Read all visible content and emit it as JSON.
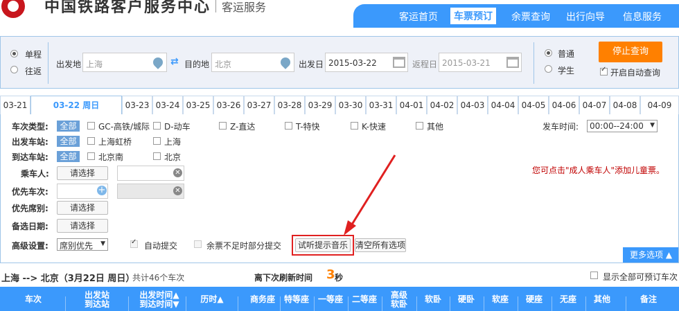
{
  "header": {
    "brand": "中国铁路客户服务中心",
    "sub": "客运服务",
    "nav": [
      "客运首页",
      "车票预订",
      "余票查询",
      "出行向导",
      "信息服务"
    ],
    "nav_active": 1
  },
  "search": {
    "trip_type": [
      "单程",
      "往返"
    ],
    "from_label": "出发地",
    "from_value": "上海",
    "to_label": "目的地",
    "to_value": "北京",
    "depart_label": "出发日",
    "depart_value": "2015-03-22",
    "return_label": "返程日",
    "return_value": "2015-03-21",
    "ticket_type": [
      "普通",
      "学生"
    ],
    "stop_button": "停止查询",
    "auto_query": "开启自动查询"
  },
  "date_tabs": [
    "03-21",
    "03-22  周日",
    "03-23",
    "03-24",
    "03-25",
    "03-26",
    "03-27",
    "03-28",
    "03-29",
    "03-30",
    "03-31",
    "04-01",
    "04-02",
    "04-03",
    "04-04",
    "04-05",
    "04-06",
    "04-07",
    "04-08",
    "04-09"
  ],
  "filters": {
    "train_type_label": "车次类型:",
    "all": "全部",
    "train_types": [
      "GC-高铁/城际",
      "D-动车",
      "Z-直达",
      "T-特快",
      "K-快速",
      "其他"
    ],
    "depart_time_label": "发车时间:",
    "depart_time_value": "00:00--24:00",
    "from_station_label": "出发车站:",
    "from_stations": [
      "上海虹桥",
      "上海"
    ],
    "to_station_label": "到达车站:",
    "to_stations": [
      "北京南",
      "北京"
    ],
    "passenger_label": "乘车人:",
    "select_btn": "请选择",
    "child_note": "您可点击\"成人乘车人\"添加儿童票。",
    "priority_train_label": "优先车次:",
    "priority_seat_label": "优先席别:",
    "alt_date_label": "备选日期:",
    "advanced_label": "高级设置:",
    "advanced_select": "席别优先",
    "auto_submit": "自动提交",
    "partial_submit": "余票不足时部分提交",
    "test_music_btn": "试听提示音乐",
    "clear_btn": "清空所有选项",
    "more_btn": "更多选项"
  },
  "result": {
    "route": "上海 --> 北京（3月22日  周日）",
    "count": "共计46个车次",
    "refresh_label": "离下次刷新时间",
    "refresh_num": "3",
    "refresh_unit": "秒",
    "show_all": "显示全部可预订车次"
  },
  "table_headers": [
    "车次",
    "出发站\n到达站",
    "出发时间▲\n到达时间▼",
    "历时▲",
    "商务座",
    "特等座",
    "一等座",
    "二等座",
    "高级\n软卧",
    "软卧",
    "硬卧",
    "软座",
    "硬座",
    "无座",
    "其他",
    "备注"
  ],
  "colors": {
    "primary": "#3b99fc",
    "accent": "#ff8000",
    "highlight": "#e02020",
    "logo": "#c8161d"
  }
}
